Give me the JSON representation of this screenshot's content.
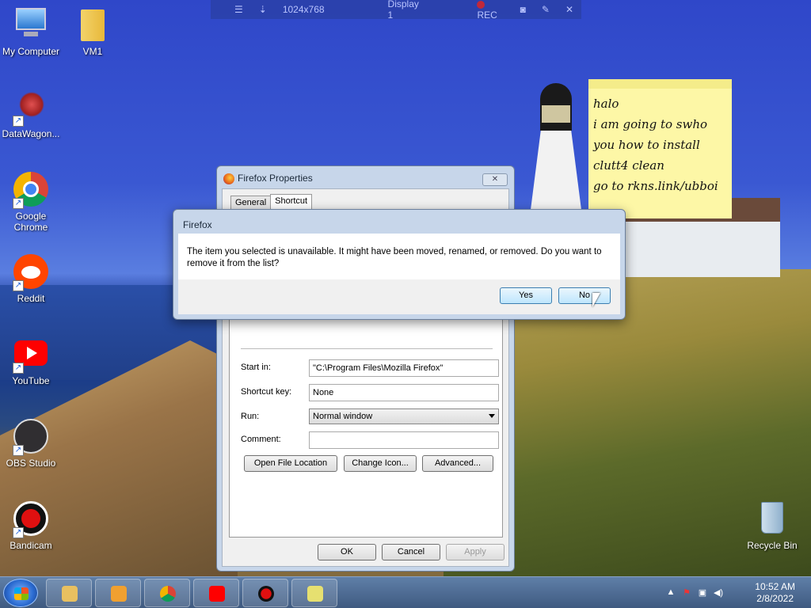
{
  "record_bar": {
    "resolution": "1024x768",
    "display": "Display 1",
    "rec_label": "REC"
  },
  "desktop_icons": [
    {
      "label": "My Computer"
    },
    {
      "label": "VM1"
    },
    {
      "label": "DataWagon..."
    },
    {
      "label": "Google Chrome"
    },
    {
      "label": "Reddit"
    },
    {
      "label": "YouTube"
    },
    {
      "label": "OBS Studio"
    },
    {
      "label": "Bandicam"
    },
    {
      "label": "Recycle Bin"
    }
  ],
  "sticky_note": {
    "lines": [
      "halo",
      "i am going to swho",
      "you how to install",
      "clutt4 clean",
      "go to rkns.link/ubboi"
    ]
  },
  "properties_window": {
    "title": "Firefox Properties",
    "tabs": [
      "General",
      "Shortcut"
    ],
    "active_tab": "Shortcut",
    "fields": {
      "start_in_label": "Start in:",
      "start_in_value": "\"C:\\Program Files\\Mozilla Firefox\"",
      "shortcut_key_label": "Shortcut key:",
      "shortcut_key_value": "None",
      "run_label": "Run:",
      "run_value": "Normal window",
      "comment_label": "Comment:",
      "comment_value": ""
    },
    "buttons": {
      "open_file_location": "Open File Location",
      "change_icon": "Change Icon...",
      "advanced": "Advanced...",
      "ok": "OK",
      "cancel": "Cancel",
      "apply": "Apply"
    }
  },
  "alert_dialog": {
    "title": "Firefox",
    "message": "The item you selected is unavailable.  It might have been moved, renamed, or removed.  Do you want to remove it from the list?",
    "yes": "Yes",
    "no": "No"
  },
  "taskbar": {
    "time": "10:52 AM",
    "date": "2/8/2022"
  },
  "colors": {
    "taskbar": "#3f5a80",
    "sticky": "#fdf7a6",
    "dialog_frame": "#c7d6ea"
  }
}
